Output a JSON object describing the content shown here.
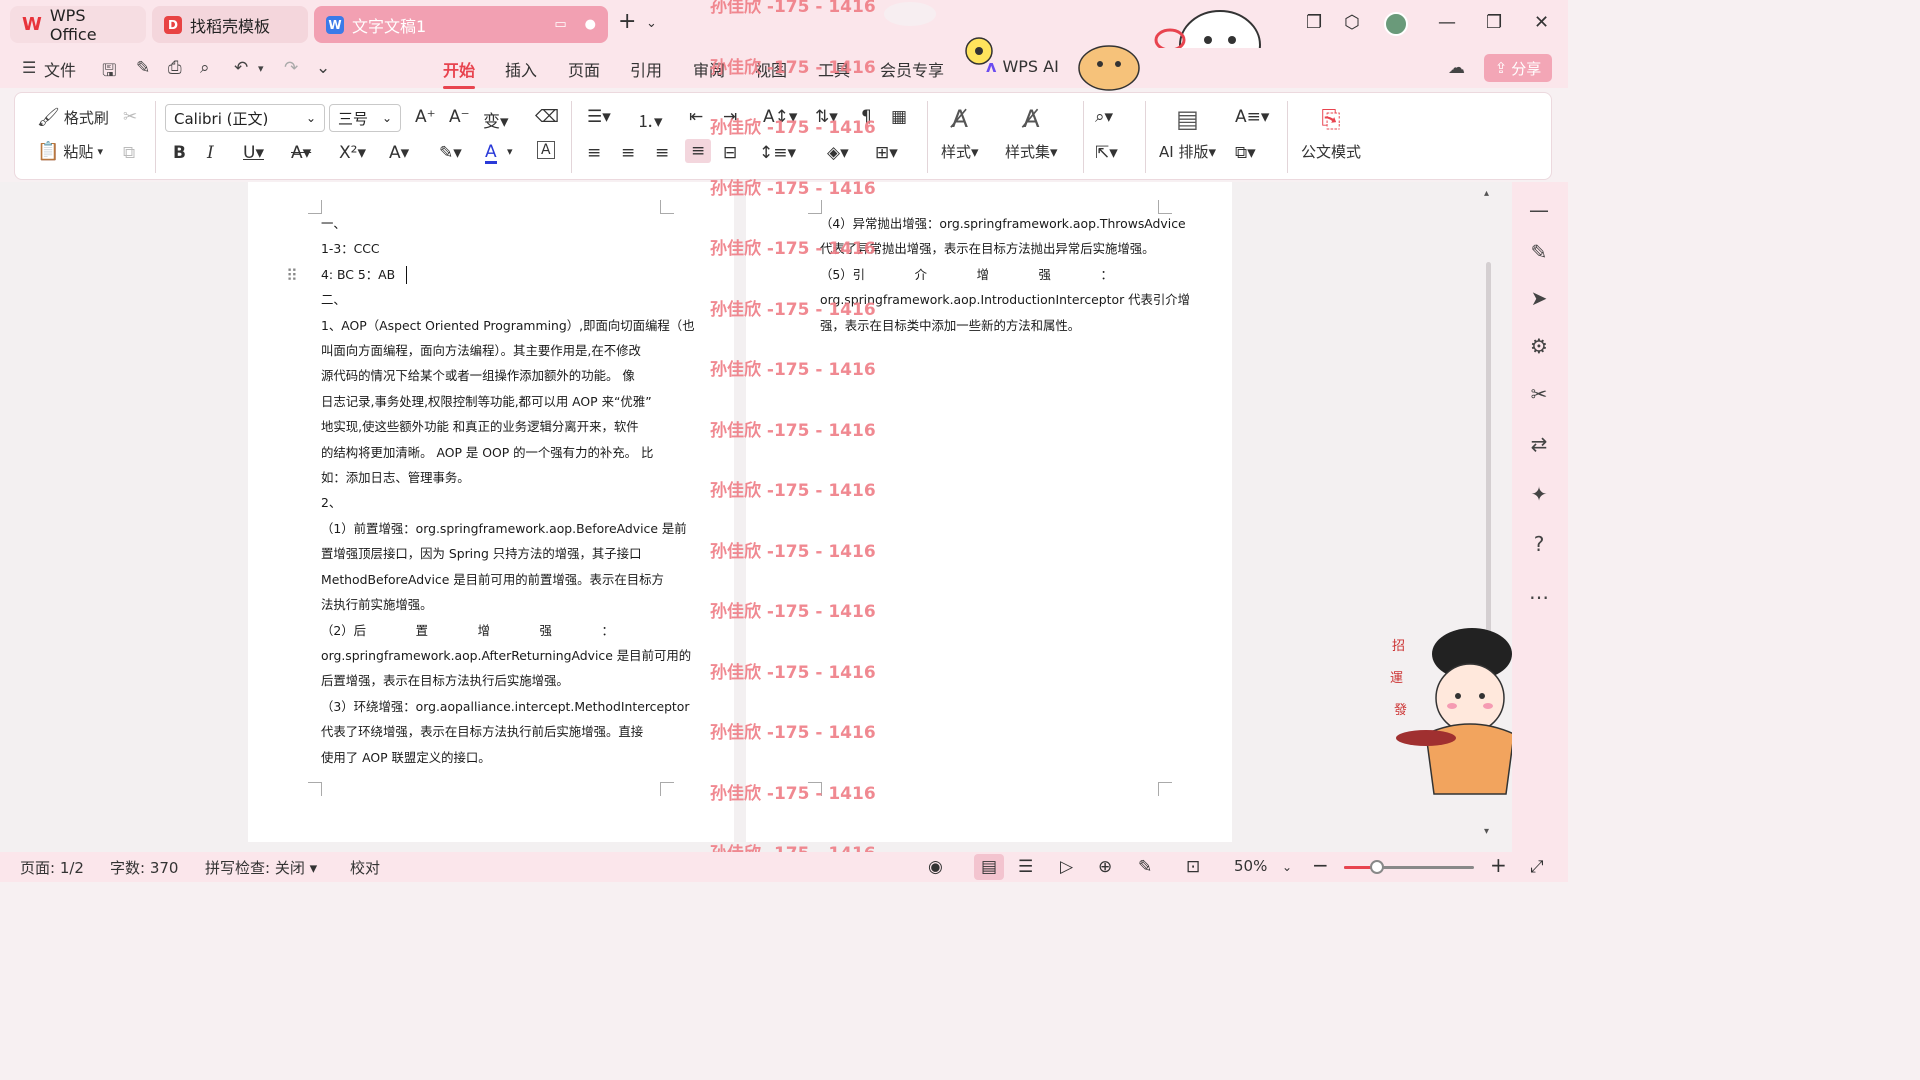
{
  "titlebar": {
    "tabs": [
      {
        "label": "WPS Office"
      },
      {
        "label": "找稻壳模板"
      },
      {
        "label": "文字文稿1"
      }
    ],
    "new_tab": "+"
  },
  "menubar": {
    "file_label": "文件",
    "tabs": [
      "开始",
      "插入",
      "页面",
      "引用",
      "审阅",
      "视图",
      "工具",
      "会员专享"
    ],
    "active_tab": "开始",
    "wps_ai": "WPS AI",
    "share": "分享"
  },
  "ribbon": {
    "format_painter": "格式刷",
    "paste": "粘贴",
    "font_name": "Calibri (正文)",
    "font_size": "三号",
    "styles": "样式",
    "style_sets": "样式集",
    "ai_layout": "AI 排版",
    "official_mode": "公文模式"
  },
  "document": {
    "page1_lines": [
      "一、",
      "1-3：CCC",
      "4:   BC    5：AB",
      "二、",
      "1、AOP（Aspect Oriented Programming）,即面向切面编程（也",
      "叫面向方面编程，面向方法编程）。其主要作用是,在不修改",
      "源代码的情况下给某个或者一组操作添加额外的功能。 像",
      "日志记录,事务处理,权限控制等功能,都可以用 AOP 来“优雅”",
      "地实现,使这些额外功能 和真正的业务逻辑分离开来，软件",
      "的结构将更加清晰。 AOP 是 OOP 的一个强有力的补充。 比",
      "如：添加日志、管理事务。",
      "2、",
      "（1）前置增强：org.springframework.aop.BeforeAdvice 是前",
      "置增强顶层接口，因为 Spring 只持方法的增强，其子接口",
      "MethodBeforeAdvice 是目前可用的前置增强。表示在目标方",
      "法执行前实施增强。",
      "（2）后　　　　置　　　　增　　　　强　　　　：",
      "org.springframework.aop.AfterReturningAdvice 是目前可用的",
      "后置增强，表示在目标方法执行后实施增强。",
      "（3）环绕增强：org.aopalliance.intercept.MethodInterceptor",
      "代表了环绕增强，表示在目标方法执行前后实施增强。直接",
      "使用了 AOP 联盟定义的接口。"
    ],
    "page2_lines": [
      "（4）异常抛出增强：org.springframework.aop.ThrowsAdvice",
      "代表了异常抛出增强，表示在目标方法抛出异常后实施增强。",
      "（5）引　　　　介　　　　增　　　　强　　　　：",
      "org.springframework.aop.IntroductionInterceptor 代表引介增",
      "强，表示在目标类中添加一些新的方法和属性。"
    ],
    "watermark": "孙佳欣 -175 - 1416"
  },
  "statusbar": {
    "page": "页面: 1/2",
    "words": "字数: 370",
    "spellcheck": "拼写检查: 关闭",
    "proofread": "校对",
    "zoom": "50%",
    "zoom_level": 0.25
  },
  "colors": {
    "accent": "#e8444f",
    "chrome": "#fbe6eb",
    "watermark": "#ef7d86"
  }
}
